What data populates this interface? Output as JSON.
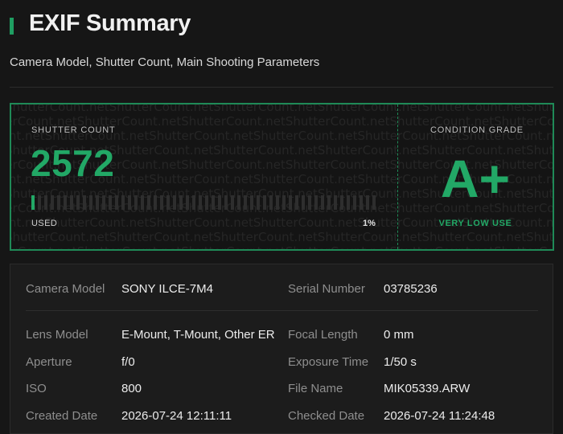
{
  "header": {
    "title": "EXIF Summary",
    "subtitle": "Camera Model, Shutter Count, Main Shooting Parameters"
  },
  "shutter": {
    "label": "SHUTTER COUNT",
    "value": "2572",
    "used_label": "USED",
    "used_percent_label": "1%",
    "used_fraction": 0.01,
    "watermark_text": "ShutterCount.net"
  },
  "condition": {
    "label": "CONDITION GRADE",
    "grade": "A+",
    "note": "VERY LOW USE"
  },
  "details": {
    "primary": {
      "left_key": "Camera Model",
      "left_value": "SONY ILCE-7M4",
      "right_key": "Serial Number",
      "right_value": "03785236"
    },
    "rows": [
      {
        "left_key": "Lens Model",
        "left_value": "E-Mount, T-Mount, Other ER",
        "right_key": "Focal Length",
        "right_value": "0 mm"
      },
      {
        "left_key": "Aperture",
        "left_value": "f/0",
        "right_key": "Exposure Time",
        "right_value": "1/50 s"
      },
      {
        "left_key": "ISO",
        "left_value": "800",
        "right_key": "File Name",
        "right_value": "MIK05339.ARW"
      },
      {
        "left_key": "Created Date",
        "left_value": "2026-07-24 12:11:11",
        "right_key": "Checked Date",
        "right_value": "2026-07-24 11:24:48"
      }
    ]
  },
  "colors": {
    "accent": "#22a866",
    "border_accent": "#1f8a57",
    "background": "#161616",
    "panel": "#1c1c1c"
  }
}
